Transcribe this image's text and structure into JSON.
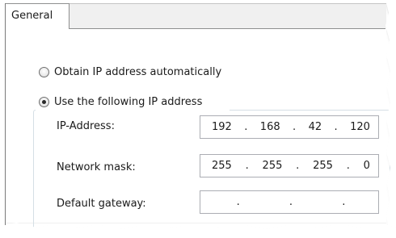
{
  "tabs": [
    {
      "label": "General"
    }
  ],
  "options": {
    "obtain_auto": {
      "label": "Obtain IP address automatically",
      "selected": false
    },
    "use_following": {
      "label": "Use the following IP address",
      "selected": true
    }
  },
  "fields": {
    "ip_address": {
      "label": "IP-Address:",
      "octets": [
        "192",
        "168",
        "42",
        "120"
      ]
    },
    "network_mask": {
      "label": "Network mask:",
      "octets": [
        "255",
        "255",
        "255",
        "0"
      ]
    },
    "default_gateway": {
      "label": "Default gateway:",
      "octets": [
        "",
        "",
        "",
        ""
      ]
    }
  },
  "separator": "."
}
